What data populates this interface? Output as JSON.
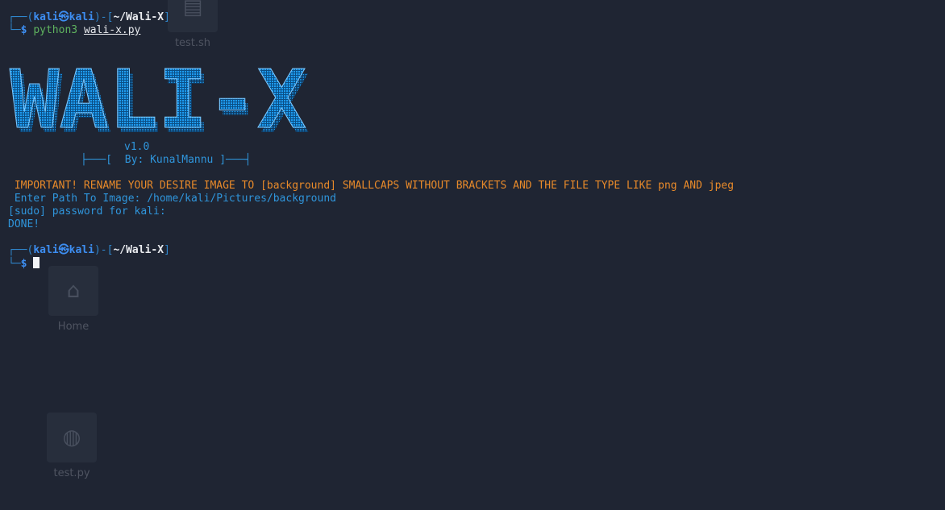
{
  "desktop": {
    "icons": [
      {
        "name": "test-sh-icon",
        "label": "test.sh",
        "glyph": "▤"
      },
      {
        "name": "home-icon",
        "label": "Home",
        "glyph": "⌂"
      },
      {
        "name": "python-file-icon",
        "label": "test.py",
        "glyph": "◍"
      }
    ]
  },
  "prompt1": {
    "frame_top": "┌──(",
    "user": "kali",
    "skull": "㉿",
    "host": "kali",
    "mid": ")-[",
    "cwd": "~/Wali-X",
    "end": "]",
    "frame_bottom": "└─",
    "dollar": "$",
    "command": "python3",
    "argument": "wali-x.py"
  },
  "banner": {
    "text": "WALI-X",
    "color": "#1e9bf0",
    "version": "v1.0",
    "credit_left": "├───[",
    "credit": "By: KunalMannu",
    "credit_right": "]───┤"
  },
  "output": {
    "important": " IMPORTANT! RENAME YOUR DESIRE IMAGE TO [background] SMALLCAPS WITHOUT BRACKETS AND THE FILE TYPE LIKE png AND jpeg",
    "path_prompt": " Enter Path To Image: ",
    "path_value": "/home/kali/Pictures/background",
    "sudo": "[sudo] password for kali:",
    "done": "DONE!"
  },
  "prompt2": {
    "frame_top": "┌──(",
    "user": "kali",
    "skull": "㉿",
    "host": "kali",
    "mid": ")-[",
    "cwd": "~/Wali-X",
    "end": "]",
    "frame_bottom": "└─",
    "dollar": "$"
  }
}
